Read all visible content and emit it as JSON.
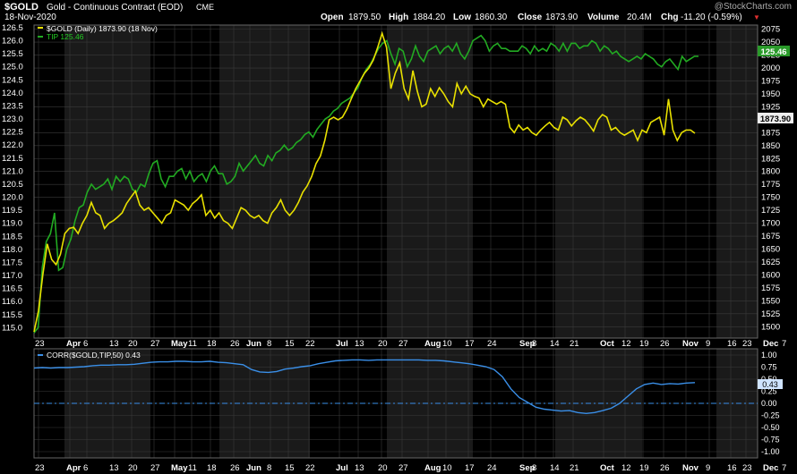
{
  "header": {
    "symbol": "$GOLD",
    "description": "Gold - Continuous Contract (EOD)",
    "exchange": "CME",
    "date": "18-Nov-2020",
    "watermark": "@StockCharts.com",
    "open_label": "Open",
    "open_value": "1879.50",
    "high_label": "High",
    "high_value": "1884.20",
    "low_label": "Low",
    "low_value": "1860.30",
    "close_label": "Close",
    "close_value": "1873.90",
    "volume_label": "Volume",
    "volume_value": "20.4M",
    "chg_label": "Chg",
    "chg_value": "-11.20 (-0.59%)",
    "chg_arrow": "▼"
  },
  "colors": {
    "gold_line": "#e8e000",
    "tip_line": "#22aa22",
    "corr_line": "#3a8fe8",
    "grid": "#3a3a3a",
    "bg": "#000000",
    "band": "#1a1a1a",
    "corr_badge": "#cfe3ff"
  },
  "chart_data": [
    {
      "type": "line",
      "legend": [
        {
          "label": "$GOLD (Daily) 1873.90 (18 Nov)",
          "color": "#e8e000"
        },
        {
          "label": "TIP 125.46",
          "color": "#22aa22"
        }
      ],
      "x_tick_labels": [
        "23",
        "Apr",
        "6",
        "13",
        "20",
        "27",
        "May",
        "11",
        "18",
        "26",
        "Jun",
        "8",
        "15",
        "22",
        "Jul",
        "13",
        "20",
        "27",
        "Aug",
        "10",
        "17",
        "24",
        "Sep",
        "8",
        "14",
        "21",
        "Oct",
        "12",
        "19",
        "26",
        "Nov",
        "9",
        "16",
        "23",
        "Dec",
        "7"
      ],
      "left_axis": {
        "name": "TIP",
        "ticks": [
          "115.0",
          "115.5",
          "116.0",
          "116.5",
          "117.0",
          "117.5",
          "118.0",
          "118.5",
          "119.0",
          "119.5",
          "120.0",
          "120.5",
          "121.0",
          "121.5",
          "122.0",
          "122.5",
          "123.0",
          "123.5",
          "124.0",
          "124.5",
          "125.0",
          "125.5",
          "126.0",
          "126.5"
        ],
        "range": [
          114.6,
          126.6
        ]
      },
      "right_axis": {
        "name": "$GOLD",
        "ticks": [
          "1500",
          "1525",
          "1550",
          "1575",
          "1600",
          "1625",
          "1650",
          "1675",
          "1700",
          "1725",
          "1750",
          "1775",
          "1800",
          "1825",
          "1850",
          "1875",
          "1900",
          "1925",
          "1950",
          "1975",
          "2000",
          "2025",
          "2050",
          "2075"
        ],
        "range": [
          1478,
          2083
        ]
      },
      "last_value_badges": {
        "tip": "125.46",
        "gold": "1873.90"
      },
      "series": [
        {
          "name": "TIP",
          "axis": "left",
          "values": [
            114.8,
            115.0,
            117.3,
            118.3,
            118.6,
            119.4,
            117.2,
            117.3,
            118.0,
            118.4,
            119.1,
            119.6,
            119.7,
            120.2,
            120.5,
            120.3,
            120.4,
            120.5,
            120.7,
            120.3,
            120.8,
            120.6,
            120.8,
            120.7,
            120.3,
            120.2,
            120.5,
            120.4,
            120.9,
            121.3,
            121.4,
            120.7,
            120.4,
            120.8,
            120.8,
            121.0,
            121.1,
            120.7,
            121.0,
            120.6,
            120.8,
            120.9,
            120.6,
            121.0,
            121.2,
            120.9,
            120.9,
            120.5,
            120.6,
            120.8,
            121.3,
            121.0,
            121.2,
            121.4,
            121.6,
            121.3,
            121.2,
            121.6,
            121.4,
            121.7,
            121.8,
            122.0,
            121.8,
            121.9,
            122.1,
            122.2,
            122.4,
            122.5,
            122.3,
            122.6,
            122.8,
            123.0,
            123.1,
            123.3,
            123.4,
            123.6,
            123.7,
            123.8,
            124.0,
            124.2,
            124.6,
            124.9,
            125.1,
            125.4,
            125.7,
            125.9,
            126.0,
            125.5,
            125.1,
            125.7,
            125.6,
            125.0,
            125.3,
            125.8,
            125.4,
            125.2,
            125.6,
            125.7,
            125.8,
            125.5,
            125.7,
            125.8,
            125.6,
            125.9,
            125.5,
            125.3,
            125.6,
            126.0,
            126.1,
            126.2,
            126.0,
            125.6,
            125.8,
            125.9,
            125.7,
            125.7,
            125.6,
            125.6,
            125.6,
            125.8,
            125.7,
            125.5,
            125.8,
            125.6,
            125.7,
            125.6,
            125.9,
            125.8,
            125.6,
            125.9,
            125.6,
            125.9,
            125.9,
            125.7,
            125.8,
            125.8,
            126.0,
            125.9,
            125.6,
            125.8,
            125.7,
            125.5,
            125.6,
            125.4,
            125.3,
            125.2,
            125.3,
            125.4,
            125.3,
            125.5,
            125.4,
            125.3,
            125.1,
            125.0,
            125.2,
            125.3,
            125.1,
            124.9,
            125.4,
            125.2,
            125.3,
            125.4,
            125.4
          ]
        },
        {
          "name": "$GOLD",
          "axis": "right",
          "values": [
            1490,
            1530,
            1600,
            1660,
            1630,
            1620,
            1640,
            1680,
            1690,
            1692,
            1680,
            1700,
            1715,
            1740,
            1720,
            1715,
            1690,
            1700,
            1705,
            1712,
            1720,
            1738,
            1750,
            1762,
            1735,
            1725,
            1730,
            1720,
            1710,
            1700,
            1715,
            1720,
            1745,
            1740,
            1735,
            1725,
            1738,
            1745,
            1755,
            1715,
            1725,
            1710,
            1720,
            1705,
            1700,
            1690,
            1710,
            1730,
            1725,
            1715,
            1710,
            1715,
            1705,
            1700,
            1720,
            1730,
            1745,
            1725,
            1715,
            1725,
            1740,
            1760,
            1772,
            1790,
            1815,
            1830,
            1860,
            1900,
            1905,
            1900,
            1905,
            1920,
            1940,
            1960,
            1975,
            1990,
            2000,
            2015,
            2040,
            2067,
            2040,
            1960,
            1990,
            2010,
            1960,
            1940,
            1995,
            1955,
            1925,
            1930,
            1960,
            1945,
            1962,
            1950,
            1935,
            1925,
            1970,
            1950,
            1965,
            1950,
            1945,
            1942,
            1925,
            1940,
            1935,
            1930,
            1935,
            1930,
            1885,
            1875,
            1890,
            1880,
            1885,
            1875,
            1870,
            1880,
            1888,
            1895,
            1885,
            1880,
            1905,
            1900,
            1888,
            1898,
            1905,
            1900,
            1890,
            1878,
            1900,
            1910,
            1905,
            1880,
            1885,
            1875,
            1870,
            1875,
            1880,
            1860,
            1880,
            1875,
            1895,
            1900,
            1905,
            1870,
            1940,
            1880,
            1860,
            1875,
            1880,
            1880,
            1873.9
          ]
        }
      ]
    },
    {
      "type": "line",
      "legend": [
        {
          "label": "CORR($GOLD,TIP,50) 0.43",
          "color": "#3a8fe8"
        }
      ],
      "x_tick_labels": [
        "23",
        "Apr",
        "6",
        "13",
        "20",
        "27",
        "May",
        "11",
        "18",
        "26",
        "Jun",
        "8",
        "15",
        "22",
        "Jul",
        "13",
        "20",
        "27",
        "Aug",
        "10",
        "17",
        "24",
        "Sep",
        "8",
        "14",
        "21",
        "Oct",
        "12",
        "19",
        "26",
        "Nov",
        "9",
        "16",
        "23",
        "Dec",
        "7"
      ],
      "right_axis": {
        "ticks": [
          "1.00",
          "0.75",
          "0.50",
          "0.25",
          "0.00",
          "-0.25",
          "-0.50",
          "-0.75",
          "-1.00"
        ],
        "range": [
          -1.0,
          1.0
        ]
      },
      "zero_line": true,
      "last_value_badge": "0.43",
      "series": [
        {
          "name": "CORR($GOLD,TIP,50)",
          "values": [
            0.73,
            0.74,
            0.73,
            0.74,
            0.74,
            0.75,
            0.76,
            0.78,
            0.79,
            0.79,
            0.8,
            0.8,
            0.81,
            0.83,
            0.85,
            0.86,
            0.86,
            0.87,
            0.87,
            0.86,
            0.86,
            0.87,
            0.85,
            0.84,
            0.82,
            0.8,
            0.7,
            0.65,
            0.64,
            0.66,
            0.71,
            0.73,
            0.76,
            0.78,
            0.82,
            0.85,
            0.88,
            0.89,
            0.9,
            0.9,
            0.89,
            0.9,
            0.9,
            0.9,
            0.9,
            0.9,
            0.9,
            0.89,
            0.89,
            0.88,
            0.86,
            0.84,
            0.82,
            0.79,
            0.76,
            0.7,
            0.55,
            0.3,
            0.12,
            0.02,
            -0.08,
            -0.12,
            -0.14,
            -0.16,
            -0.15,
            -0.19,
            -0.21,
            -0.19,
            -0.15,
            -0.1,
            0.0,
            0.15,
            0.3,
            0.39,
            0.42,
            0.39,
            0.41,
            0.4,
            0.42,
            0.43
          ]
        }
      ]
    }
  ]
}
